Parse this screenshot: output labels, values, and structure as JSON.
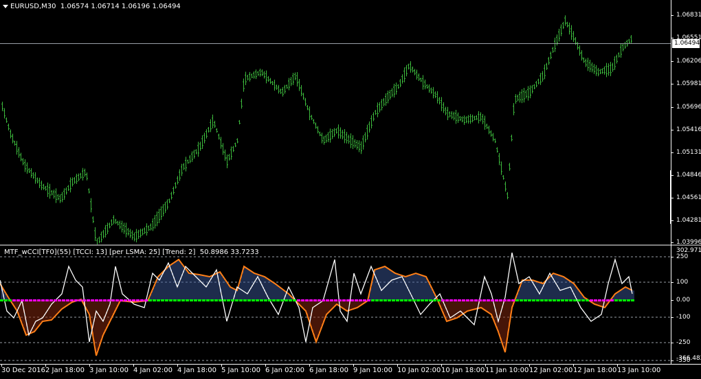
{
  "header": {
    "symbol_tf": "EURUSD,M30",
    "ohlc": "1.06574 1.06714 1.06196 1.06494"
  },
  "price_axis": {
    "labels": [
      "1.06831",
      "1.06551",
      "1.06206",
      "1.05981",
      "1.05696",
      "1.05416",
      "1.05131",
      "1.04846",
      "1.04561",
      "1.04281",
      "1.03996"
    ],
    "current_price": "1.06494"
  },
  "indicator": {
    "title": "MTF_wCCI[TF0](55) [TCCI: 13] [per LSMA: 25] [Trend: 2]",
    "values": "50.8986 33.7233",
    "axis_top": "302.9717",
    "axis_bottom": "-366.4826",
    "levels": [
      "250",
      "100",
      "0.00",
      "-100",
      "-250",
      "-350"
    ]
  },
  "time_axis": [
    "30 Dec 2016",
    "2 Jan 18:00",
    "3 Jan 10:00",
    "4 Jan 02:00",
    "4 Jan 18:00",
    "5 Jan 10:00",
    "6 Jan 02:00",
    "6 Jan 18:00",
    "9 Jan 10:00",
    "10 Jan 02:00",
    "10 Jan 18:00",
    "11 Jan 10:00",
    "12 Jan 02:00",
    "12 Jan 18:00",
    "13 Jan 10:00"
  ],
  "colors": {
    "background": "#000000",
    "bar": "#3cb83c",
    "cci_white": "#ffffff",
    "cci_orange": "#ff7f17",
    "hist_up": "#3b5998",
    "hist_down": "#8b2a10",
    "trend_up": "#00ff00",
    "trend_down": "#ff00ff",
    "grid": "#9aa0a8"
  }
}
